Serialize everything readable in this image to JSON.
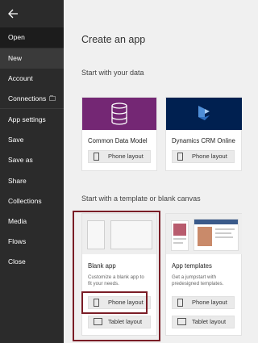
{
  "sidebar": {
    "items": [
      {
        "label": "Open"
      },
      {
        "label": "New"
      },
      {
        "label": "Account"
      },
      {
        "label": "Connections"
      },
      {
        "label": "App settings"
      },
      {
        "label": "Save"
      },
      {
        "label": "Save as"
      },
      {
        "label": "Share"
      },
      {
        "label": "Collections"
      },
      {
        "label": "Media"
      },
      {
        "label": "Flows"
      },
      {
        "label": "Close"
      }
    ]
  },
  "main": {
    "title": "Create an app",
    "data_section": "Start with your data",
    "template_section": "Start with a template or blank canvas",
    "data_cards": [
      {
        "label": "Common Data Model",
        "button": "Phone layout",
        "color": "#742774"
      },
      {
        "label": "Dynamics CRM Online",
        "button": "Phone layout",
        "color": "#002050"
      }
    ],
    "template_cards": [
      {
        "label": "Blank app",
        "desc_line1": "Customize a blank app to",
        "desc_line2": "fit your needs.",
        "phone_button": "Phone layout",
        "tablet_button": "Tablet layout"
      },
      {
        "label": "App templates",
        "desc_line1": "Get a jumpstart with",
        "desc_line2": "predesigned templates.",
        "phone_button": "Phone layout",
        "tablet_button": "Tablet layout"
      }
    ]
  },
  "colors": {
    "sidebar_bg": "#2b2b2b",
    "highlight": "#7a1d26"
  }
}
